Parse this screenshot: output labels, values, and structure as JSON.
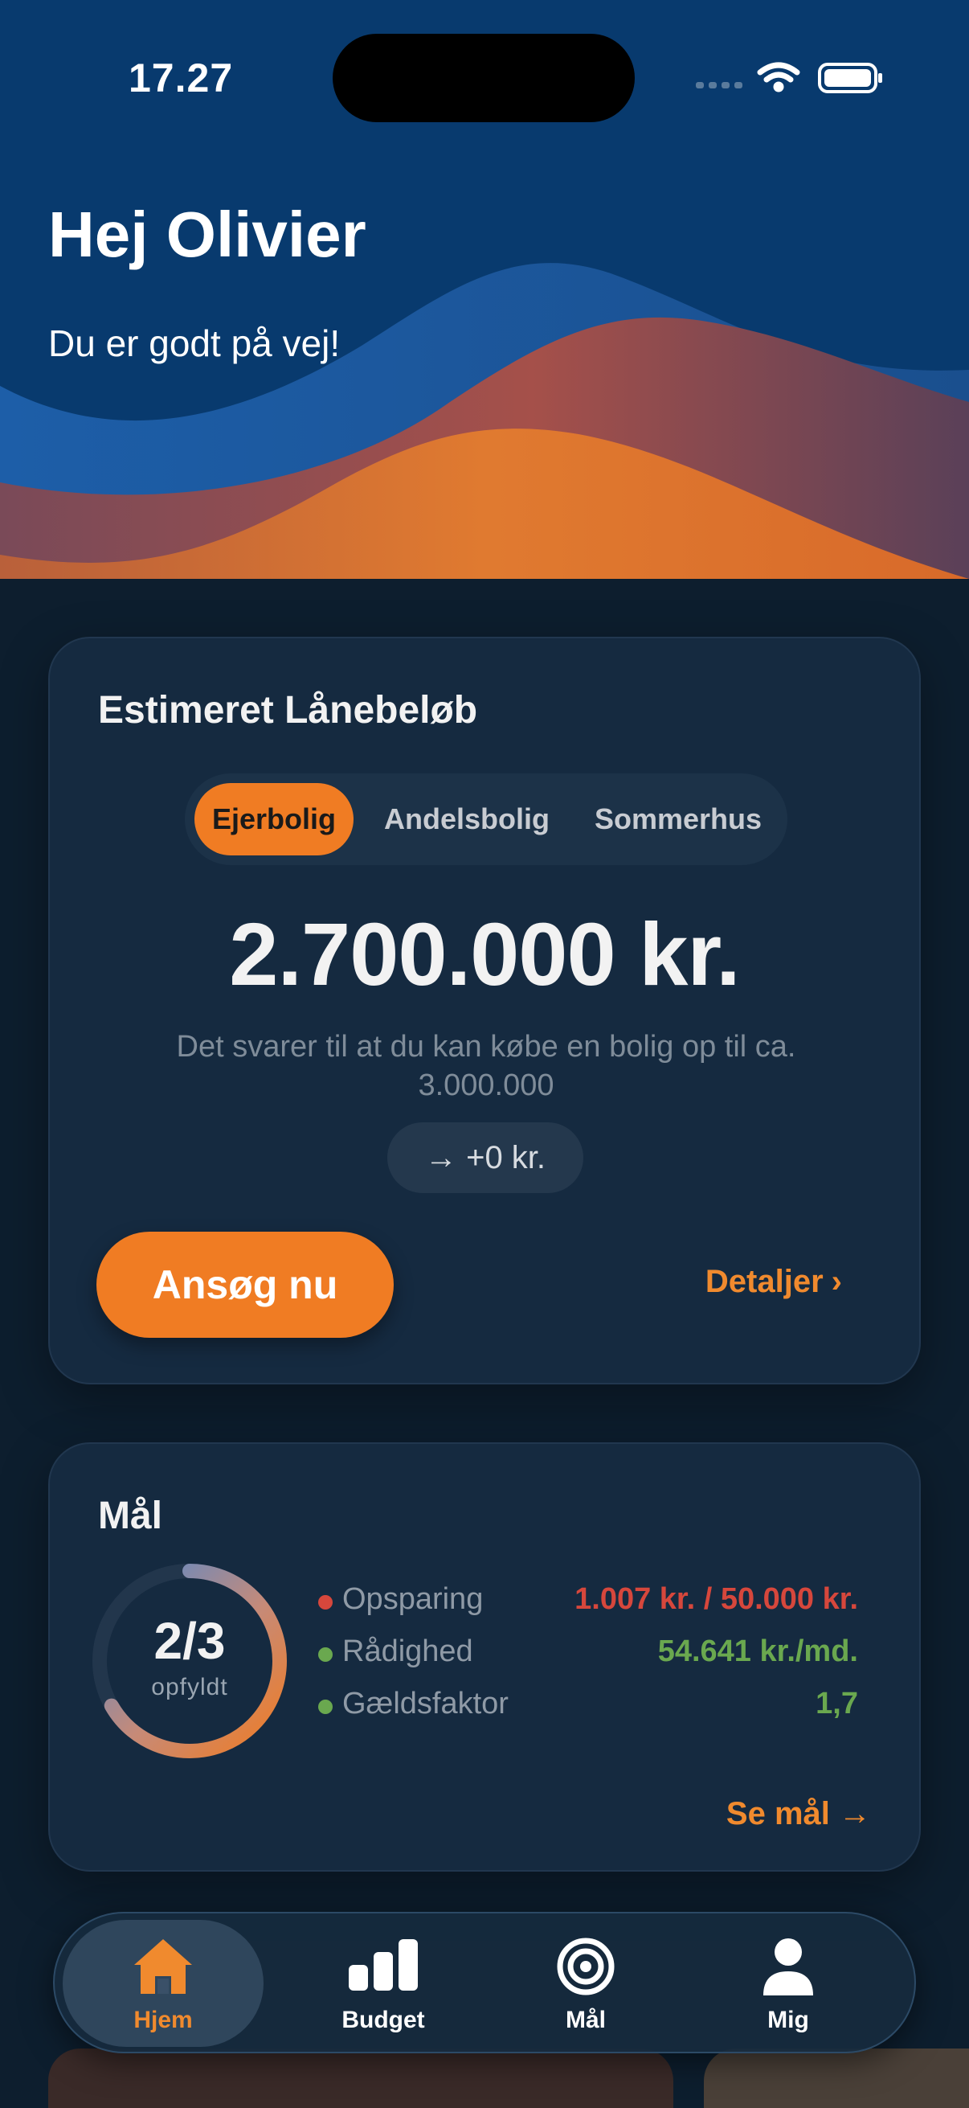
{
  "status_bar": {
    "time": "17.27"
  },
  "header": {
    "greeting": "Hej Olivier",
    "subtitle": "Du er godt på vej!"
  },
  "loan_card": {
    "title": "Estimeret Lånebeløb",
    "tabs": [
      {
        "label": "Ejerbolig",
        "active": true
      },
      {
        "label": "Andelsbolig",
        "active": false
      },
      {
        "label": "Sommerhus",
        "active": false
      }
    ],
    "amount": "2.700.000 kr.",
    "description": "Det svarer til at du kan købe en bolig op til ca. 3.000.000",
    "delta": "+0 kr.",
    "apply_label": "Ansøg nu",
    "details_label": "Detaljer"
  },
  "goals_card": {
    "title": "Mål",
    "progress_value": "2/3",
    "progress_label": "opfyldt",
    "progress_fraction": 0.667,
    "items": [
      {
        "name": "Opsparing",
        "value": "1.007 kr. / 50.000 kr.",
        "status": "red"
      },
      {
        "name": "Rådighed",
        "value": "54.641 kr./md.",
        "status": "green"
      },
      {
        "name": "Gældsfaktor",
        "value": "1,7",
        "status": "green"
      }
    ],
    "see_goals_label": "Se mål"
  },
  "colors": {
    "accent": "#f07c23",
    "red": "#d6473c",
    "green": "#6aa84f",
    "card": "#152a40"
  },
  "tabbar": {
    "items": [
      {
        "label": "Hjem",
        "icon": "home-icon",
        "active": true
      },
      {
        "label": "Budget",
        "icon": "bar-chart-icon",
        "active": false
      },
      {
        "label": "Mål",
        "icon": "target-icon",
        "active": false
      },
      {
        "label": "Mig",
        "icon": "person-icon",
        "active": false
      }
    ]
  }
}
